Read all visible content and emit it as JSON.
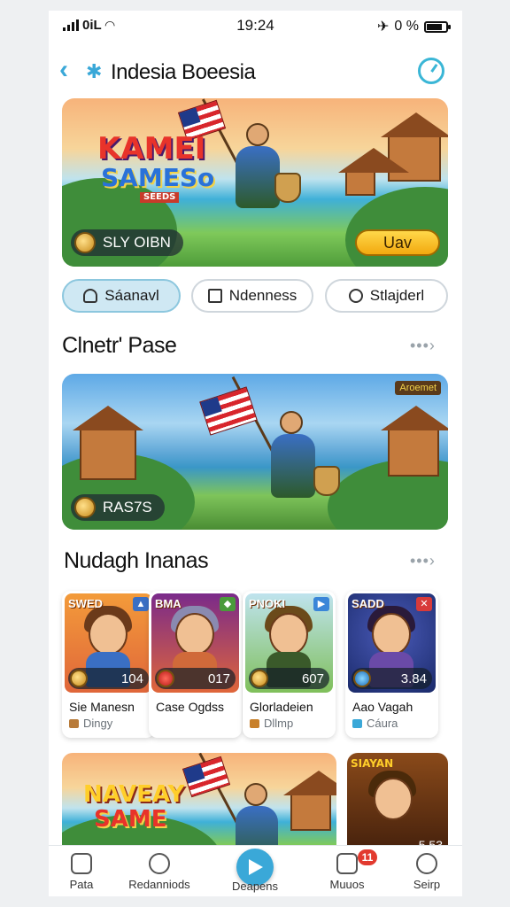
{
  "status": {
    "carrier": "0iL",
    "time": "19:24",
    "battery_text": "0 %"
  },
  "header": {
    "title": "Indesia Boeesia"
  },
  "hero": {
    "logo_line1": "KAMEI",
    "logo_line2": "SAMESo",
    "logo_line3": "SEEDS",
    "stat_label": "SLY OIBN",
    "cta_label": "Uav"
  },
  "filters": [
    {
      "label": "Sáanavl",
      "icon": "bell-icon"
    },
    {
      "label": "Ndenness",
      "icon": "home-icon"
    },
    {
      "label": "Stlajderl",
      "icon": "person-icon"
    }
  ],
  "section1": {
    "title": "Clnetr' Pase",
    "more": "•••›"
  },
  "promo": {
    "stat_label": "RAS7S",
    "corner_badge": "Aroemet"
  },
  "section2": {
    "title": "Nudagh Inanas",
    "more": "•••›"
  },
  "cards": [
    {
      "badge": "SWED",
      "value": "104",
      "name": "Sie Manesn",
      "sub": "Dingy",
      "bg": "#f39b3a",
      "hair": "#6b3a1a",
      "torso": "#3a6fc4",
      "badge_color": "#3a6fc4",
      "sub_color": "#b87b3a"
    },
    {
      "badge": "BMA",
      "value": "017",
      "name": "Case Ogdss",
      "sub": "",
      "bg": "#c8562a",
      "hair": "#8a8ab0",
      "torso": "#d06a3a",
      "badge_color": "#4a9a3a",
      "sub_color": "#c8562a"
    },
    {
      "badge": "PNOKI",
      "value": "607",
      "name": "Glorladeien",
      "sub": "Dllmp",
      "bg": "#7fbf5a",
      "hair": "#6b4a1a",
      "torso": "#3a5a2a",
      "badge_color": "#3a86d8",
      "sub_color": "#c8802a"
    },
    {
      "badge": "SADD",
      "value": "3.84",
      "name": "Aao Vagah",
      "sub": "Cáura",
      "bg": "#2a3a8a",
      "hair": "#2a1a3a",
      "torso": "#6a4aa8",
      "badge_color": "#d83a3a",
      "sub_color": "#3aa8d8"
    }
  ],
  "bottom_row": {
    "logo_line1": "NAVEAY",
    "logo_line2": "SAME",
    "right_badge": "SIAYAN",
    "right_value": "5.53"
  },
  "tabbar": {
    "tabs": [
      "Pata",
      "Redanniods",
      "Deapens",
      "Muuos",
      "Seirp"
    ],
    "notif_count": "11"
  }
}
